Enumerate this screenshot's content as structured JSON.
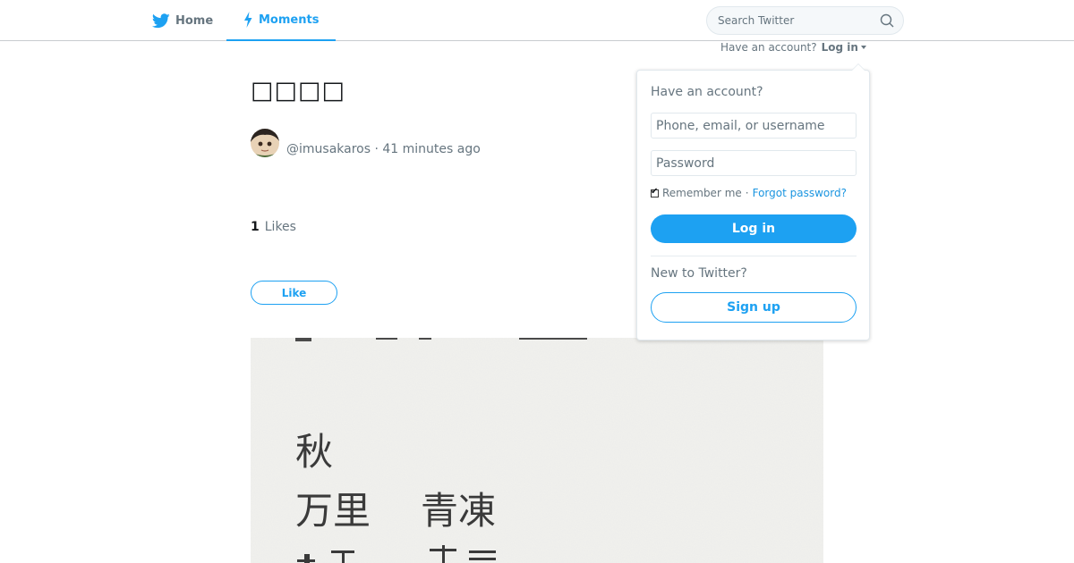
{
  "nav": {
    "home_label": "Home",
    "moments_label": "Moments",
    "search_placeholder": "Search Twitter",
    "account_prompt": "Have an account?",
    "login_label": "Log in"
  },
  "moment": {
    "title": "□□□□",
    "author_handle": "@imusakaros",
    "separator": "·",
    "timestamp": "41 minutes ago",
    "likes_count": "1",
    "likes_label": "Likes",
    "like_button": "Like",
    "image_text": [
      "秋",
      "万里",
      "青凍"
    ]
  },
  "login_dropdown": {
    "heading": "Have an account?",
    "username_placeholder": "Phone, email, or username",
    "password_placeholder": "Password",
    "remember_label": "Remember me",
    "separator": "·",
    "forgot_label": "Forgot password?",
    "login_button": "Log in",
    "new_heading": "New to Twitter?",
    "signup_button": "Sign up"
  },
  "colors": {
    "brand_blue": "#1da1f2",
    "text_secondary": "#66757f",
    "text_primary": "#14171a"
  },
  "icons": [
    "twitter-bird-icon",
    "lightning-icon",
    "search-icon",
    "caret-down-icon"
  ]
}
